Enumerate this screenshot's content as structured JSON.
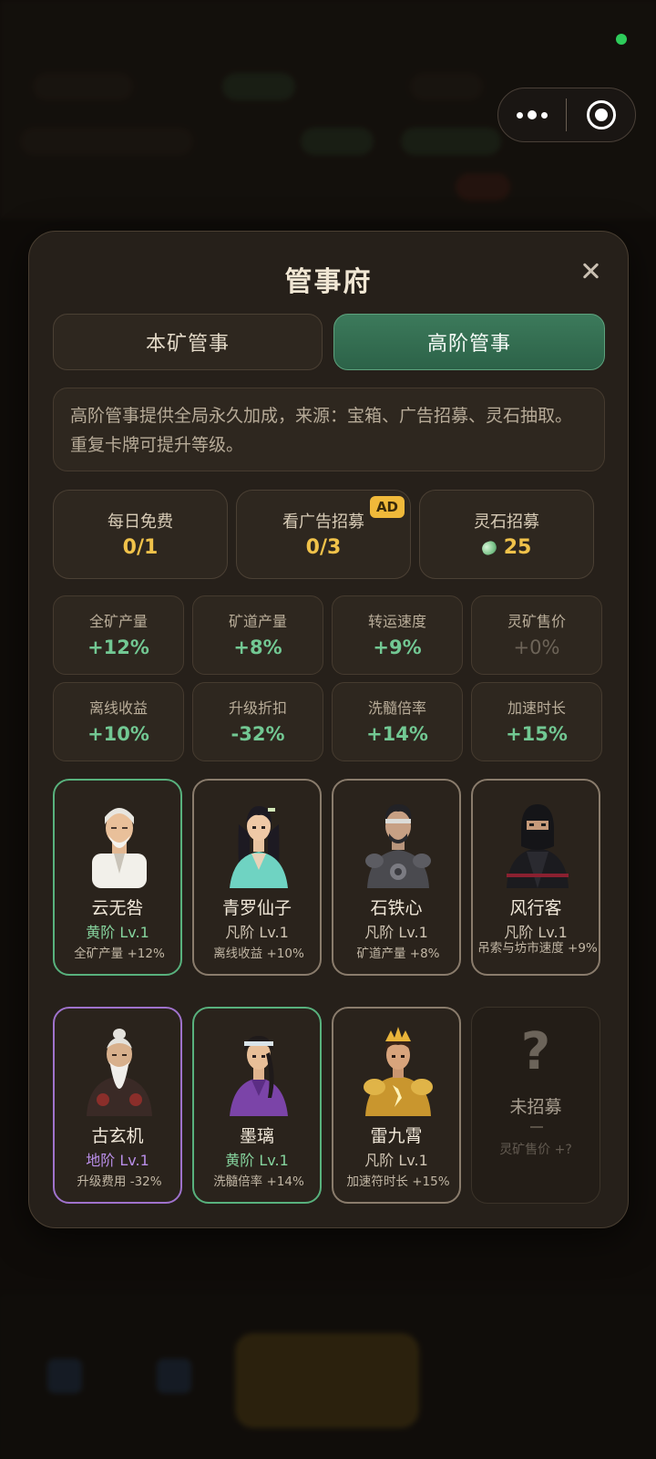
{
  "modal": {
    "title": "管事府",
    "tabs": [
      {
        "label": "本矿管事",
        "active": false
      },
      {
        "label": "高阶管事",
        "active": true
      }
    ],
    "description": "高阶管事提供全局永久加成，来源：宝箱、广告招募、灵石抽取。重复卡牌可提升等级。"
  },
  "recruit": [
    {
      "label": "每日免费",
      "value": "0/1"
    },
    {
      "label": "看广告招募",
      "value": "0/3",
      "badge": "AD"
    },
    {
      "label": "灵石招募",
      "value": "25",
      "icon": "spirit-stone-icon"
    }
  ],
  "stats": [
    {
      "label": "全矿产量",
      "value": "+12%"
    },
    {
      "label": "矿道产量",
      "value": "+8%"
    },
    {
      "label": "转运速度",
      "value": "+9%"
    },
    {
      "label": "灵矿售价",
      "value": "+0%"
    },
    {
      "label": "离线收益",
      "value": "+10%"
    },
    {
      "label": "升级折扣",
      "value": "-32%"
    },
    {
      "label": "洗髓倍率",
      "value": "+14%"
    },
    {
      "label": "加速时长",
      "value": "+15%"
    }
  ],
  "managers": [
    {
      "name": "云无咎",
      "rank": "黄阶 Lv.1",
      "bonus": "全矿产量 +12%",
      "tier": "yellow"
    },
    {
      "name": "青罗仙子",
      "rank": "凡阶 Lv.1",
      "bonus": "离线收益 +10%",
      "tier": "common"
    },
    {
      "name": "石铁心",
      "rank": "凡阶 Lv.1",
      "bonus": "矿道产量 +8%",
      "tier": "common"
    },
    {
      "name": "风行客",
      "rank": "凡阶 Lv.1",
      "bonus": "吊索与坊市速度 +9%",
      "tier": "common"
    },
    {
      "name": "古玄机",
      "rank": "地阶 Lv.1",
      "bonus": "升级费用 -32%",
      "tier": "purple"
    },
    {
      "name": "墨璃",
      "rank": "黄阶 Lv.1",
      "bonus": "洗髓倍率 +14%",
      "tier": "yellow"
    },
    {
      "name": "雷九霄",
      "rank": "凡阶 Lv.1",
      "bonus": "加速符时长 +15%",
      "tier": "common"
    }
  ],
  "unrecruited": {
    "mark": "?",
    "label": "未招募",
    "bonus": "灵矿售价 +?"
  },
  "colors": {
    "accent_green": "#3c7a5b",
    "positive": "#72c893",
    "gold": "#f0c24a",
    "purple": "#9f72cc"
  }
}
